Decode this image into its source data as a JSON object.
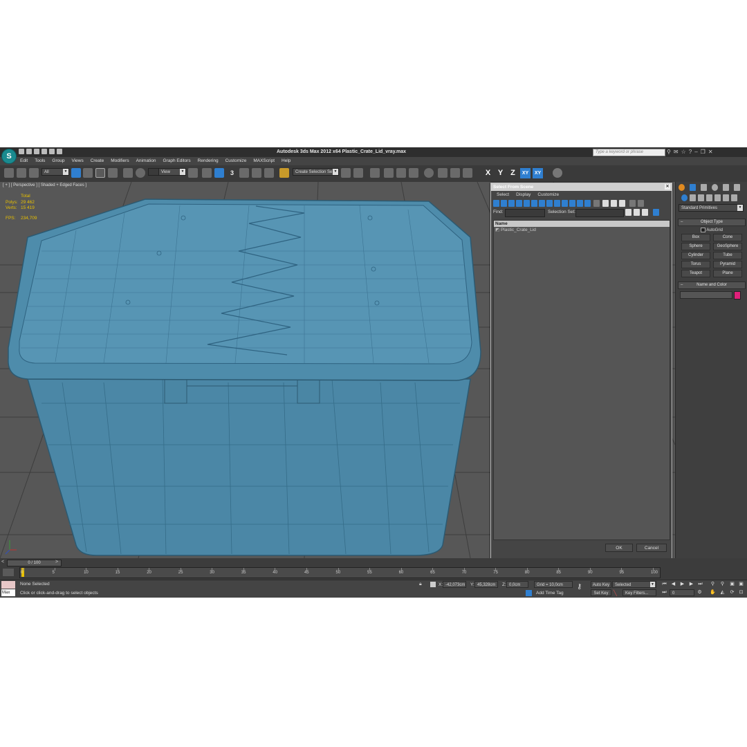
{
  "app": {
    "title": "Autodesk 3ds Max  2012 x64     Plastic_Crate_Lid_vray.max",
    "search_placeholder": "Type a keyword or phrase",
    "logo_text": "S",
    "menu": [
      "Edit",
      "Tools",
      "Group",
      "Views",
      "Create",
      "Modifiers",
      "Animation",
      "Graph Editors",
      "Rendering",
      "Customize",
      "MAXScript",
      "Help"
    ]
  },
  "toolbar": {
    "selection_filter": "All",
    "reference_coord": "View",
    "named_selection": "Create Selection Se",
    "snap_label": "3",
    "axes": [
      "X",
      "Y",
      "Z",
      "XY",
      "XY"
    ]
  },
  "viewport": {
    "label": "[ + ] [ Perspective ] [ Shaded + Edged Faces ]",
    "stats": {
      "header": "Total",
      "polys_label": "Polys:",
      "polys": "29 462",
      "verts_label": "Verts:",
      "verts": "15 419",
      "fps_label": "FPS:",
      "fps": "234,709"
    },
    "colors": {
      "model": "#4a88a8",
      "wire": "#2b5c78",
      "grid": "#3a3a3a",
      "background": "#575757"
    }
  },
  "select_dialog": {
    "title": "Select From Scene",
    "menu": [
      "Select",
      "Display",
      "Customize"
    ],
    "find_label": "Find:",
    "selection_set_label": "Selection Set:",
    "column_name": "Name",
    "items": [
      "Plastic_Crate_Lid"
    ],
    "ok": "OK",
    "cancel": "Cancel"
  },
  "command_panel": {
    "category": "Standard Primitives",
    "object_type_title": "Object Type",
    "autogrid": "AutoGrid",
    "primitives": [
      "Box",
      "Cone",
      "Sphere",
      "GeoSphere",
      "Cylinder",
      "Tube",
      "Torus",
      "Pyramid",
      "Teapot",
      "Plane"
    ],
    "name_color_title": "Name and Color",
    "object_color": "#e0207a"
  },
  "timeline": {
    "slider": "0 / 100",
    "ticks": [
      "0",
      "5",
      "10",
      "15",
      "20",
      "25",
      "30",
      "35",
      "40",
      "45",
      "50",
      "55",
      "60",
      "65",
      "70",
      "75",
      "80",
      "85",
      "90",
      "95",
      "100"
    ]
  },
  "status": {
    "listener": "Max",
    "selection": "None Selected",
    "prompt": "Click or click-and-drag to select objects",
    "x_label": "X:",
    "x": "-42,073cm",
    "y_label": "Y:",
    "y": "45,328cm",
    "z_label": "Z:",
    "z": "0,0cm",
    "grid": "Grid = 10,0cm",
    "add_time_tag": "Add Time Tag",
    "auto_key": "Auto Key",
    "set_key": "Set Key",
    "key_mode": "Selected",
    "key_filters": "Key Filters...",
    "frame": "0"
  }
}
